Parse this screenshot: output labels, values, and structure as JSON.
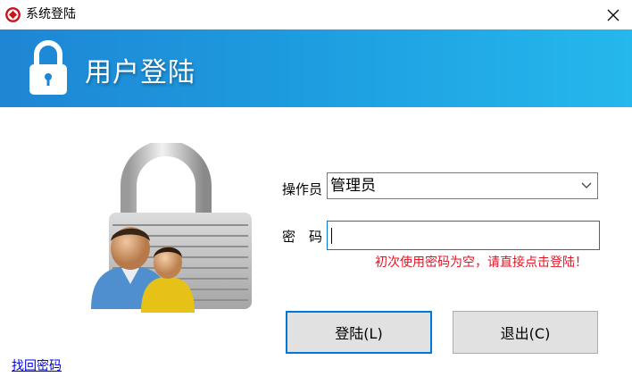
{
  "window": {
    "title": "系统登陆",
    "close_icon": "close-icon",
    "app_icon": "app-logo-icon"
  },
  "banner": {
    "title": "用户登陆",
    "icon": "padlock-icon",
    "colors": {
      "start": "#1e86d4",
      "end": "#25b8ec"
    }
  },
  "form": {
    "operator_label": "操作员",
    "operator_value": "管理员",
    "password_label": "密　码",
    "password_value": "",
    "hint": "初次使用密码为空，请直接点击登陆！",
    "hint_color": "#e81123"
  },
  "buttons": {
    "login": "登陆(L)",
    "exit": "退出(C)"
  },
  "links": {
    "recover_password": "找回密码"
  }
}
